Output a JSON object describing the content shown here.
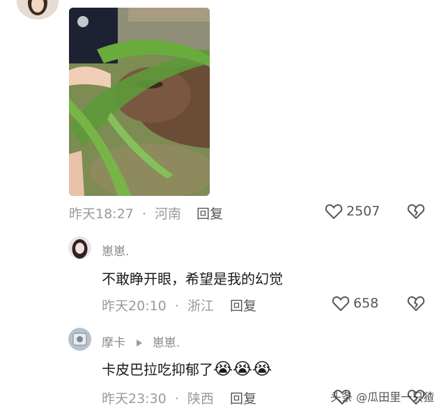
{
  "comments": [
    {
      "time": "昨天18:27",
      "sep": "·",
      "location": "河南",
      "reply_label": "回复",
      "likes": "2507"
    },
    {
      "user": "崽崽.",
      "text": "不敢睁开眼，希望是我的幻觉",
      "time": "昨天20:10",
      "sep": "·",
      "location": "浙江",
      "reply_label": "回复",
      "likes": "658"
    },
    {
      "user": "摩卡",
      "reply_to": "崽崽.",
      "text": "卡皮巴拉吃抑郁了",
      "emoji": [
        "😭",
        "😭",
        "😭"
      ],
      "time": "昨天23:30",
      "sep": "·",
      "location": "陕西",
      "reply_label": "回复"
    }
  ],
  "watermark": "头条 @瓜田里一只猹",
  "colors": {
    "icon": "#555555",
    "meta": "#9a9a9a"
  }
}
